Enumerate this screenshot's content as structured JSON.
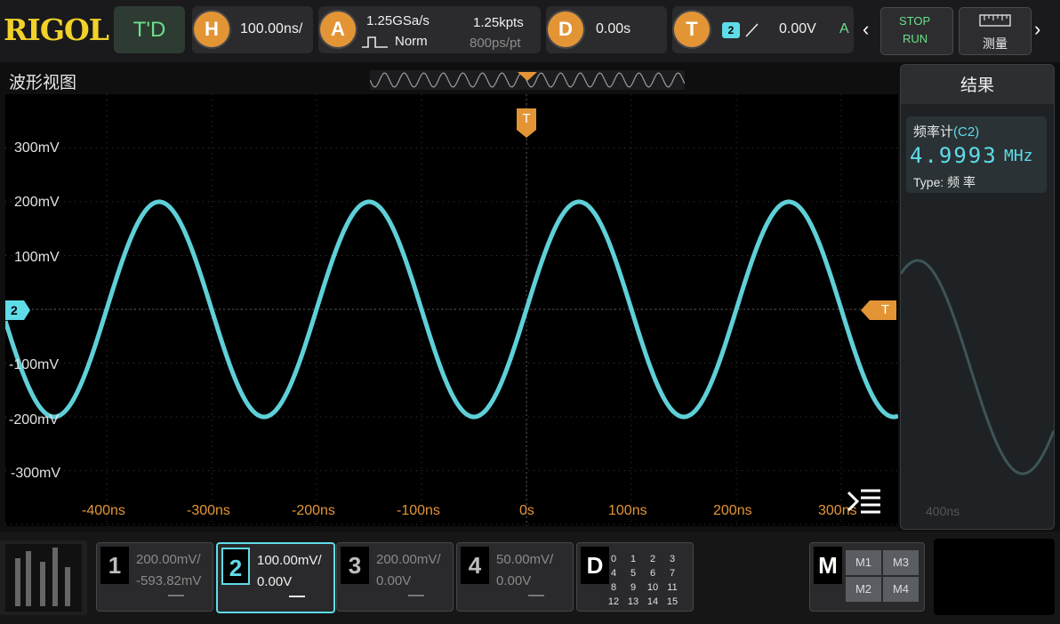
{
  "brand": "RIGOL",
  "topbar": {
    "mode": "T'D",
    "horizontal": {
      "badge": "H",
      "value": "100.00ns/"
    },
    "acquire": {
      "badge": "A",
      "rate": "1.25GSa/s",
      "mode": "Norm",
      "points": "1.25kpts",
      "per_point": "800ps/pt"
    },
    "delay": {
      "badge": "D",
      "value": "0.00s"
    },
    "trigger": {
      "badge": "T",
      "source": "2",
      "level": "0.00V",
      "sweep": "A"
    },
    "run_state": {
      "stop": "STOP",
      "run": "RUN"
    },
    "measure_label": "测量"
  },
  "view": {
    "title": "波形视图",
    "trigger_marker": "T",
    "channel_marker": "2",
    "level_marker": "T",
    "y_ticks": [
      "300mV",
      "200mV",
      "100mV",
      "-100mV",
      "-200mV",
      "-300mV"
    ],
    "x_ticks": [
      "-400ns",
      "-300ns",
      "-200ns",
      "-100ns",
      "0s",
      "100ns",
      "200ns",
      "300ns"
    ],
    "trace_color": "#5fd0d8",
    "waveform": {
      "frequency_mhz": 4.9993,
      "amplitude_mv": 200,
      "time_span_ns": 1000
    }
  },
  "results": {
    "title": "结果",
    "measurement_name": "频率计",
    "measurement_channel": "(C2)",
    "value": "4.9993",
    "unit": "MHz",
    "type_label": "Type:",
    "type_value": "频 率",
    "ghost_tick": "400ns"
  },
  "channels": [
    {
      "num": "1",
      "scale": "200.00mV/",
      "offset": "-593.82mV",
      "active": false
    },
    {
      "num": "2",
      "scale": "100.00mV/",
      "offset": "0.00V",
      "active": true
    },
    {
      "num": "3",
      "scale": "200.00mV/",
      "offset": "0.00V",
      "active": false
    },
    {
      "num": "4",
      "scale": "50.00mV/",
      "offset": "0.00V",
      "active": false
    }
  ],
  "digital": {
    "label": "D",
    "bits": [
      "0",
      "1",
      "2",
      "3",
      "4",
      "5",
      "6",
      "7",
      "8",
      "9",
      "10",
      "11",
      "12",
      "13",
      "14",
      "15"
    ]
  },
  "math": {
    "label": "M",
    "items": [
      "M1",
      "M3",
      "M2",
      "M4"
    ]
  },
  "colors": {
    "accent_orange": "#e39536",
    "ch2_cyan": "#5fdce8",
    "brand_yellow": "#f2d22a",
    "run_green": "#69e089"
  }
}
